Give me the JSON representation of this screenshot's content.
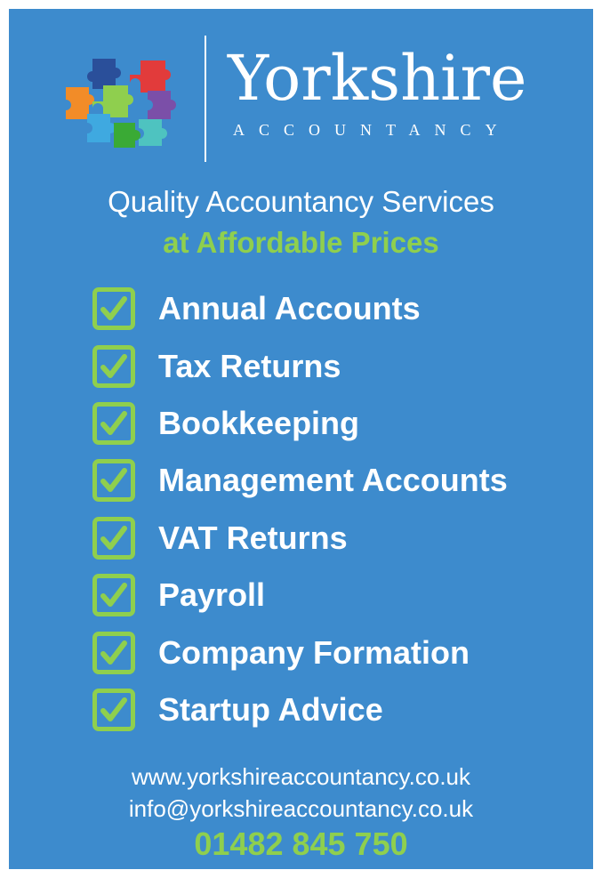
{
  "logo": {
    "brand_name": "Yorkshire",
    "brand_sub": "ACCOUNTANCY",
    "icon": "puzzle-pieces-icon"
  },
  "tagline": {
    "line1": "Quality Accountancy Services",
    "line2": "at Affordable Prices"
  },
  "services": [
    {
      "label": "Annual Accounts"
    },
    {
      "label": "Tax Returns"
    },
    {
      "label": "Bookkeeping"
    },
    {
      "label": "Management Accounts"
    },
    {
      "label": "VAT Returns"
    },
    {
      "label": "Payroll"
    },
    {
      "label": "Company Formation"
    },
    {
      "label": "Startup Advice"
    }
  ],
  "contact": {
    "website": "www.yorkshireaccountancy.co.uk",
    "email": "info@yorkshireaccountancy.co.uk",
    "phone": "01482 845 750"
  },
  "colors": {
    "background": "#3d8bcd",
    "accent_green": "#8fcf4e",
    "text": "#ffffff"
  }
}
